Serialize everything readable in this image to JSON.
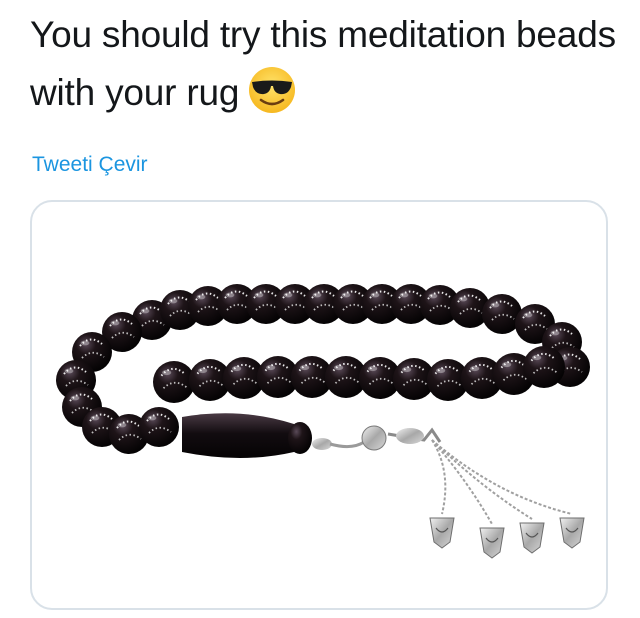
{
  "tweet": {
    "text": "You should try this meditation beads with your rug",
    "emoji": "smiling-face-with-sunglasses"
  },
  "translate_link": "Tweeti Çevir",
  "media": {
    "subject": "prayer-beads"
  }
}
